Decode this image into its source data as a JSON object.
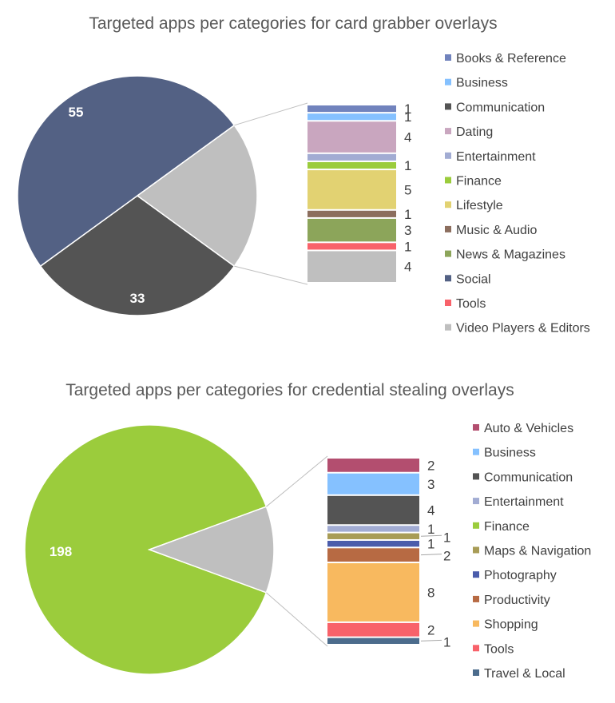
{
  "chart_data": [
    {
      "type": "pie",
      "subtype": "bar-of-pie",
      "title": "Targeted apps per categories for card grabber overlays",
      "legend_position": "right",
      "pie": [
        {
          "label": "Social",
          "value": 55,
          "color": "#536184"
        },
        {
          "label": "Communication",
          "value": 33,
          "color": "#545454"
        },
        {
          "label": "Other",
          "value": 22,
          "color": "#bfbfbf"
        }
      ],
      "bar": [
        {
          "label": "Books & Reference",
          "value": 1,
          "color": "#7183bd",
          "show_label": true
        },
        {
          "label": "Business",
          "value": 1,
          "color": "#85c1ff",
          "show_label": true
        },
        {
          "label": "Dating",
          "value": 4,
          "color": "#c9a6bf",
          "show_label": true
        },
        {
          "label": "Entertainment",
          "value": 1,
          "color": "#a2acd3",
          "show_label": false
        },
        {
          "label": "Finance",
          "value": 1,
          "color": "#9bcc3c",
          "show_label": true
        },
        {
          "label": "Lifestyle",
          "value": 5,
          "color": "#e2d272",
          "show_label": true
        },
        {
          "label": "Music & Audio",
          "value": 1,
          "color": "#8c6e5e",
          "show_label": true
        },
        {
          "label": "News & Magazines",
          "value": 3,
          "color": "#8ca55a",
          "show_label": true
        },
        {
          "label": "Tools",
          "value": 1,
          "color": "#f8626a",
          "show_label": true
        },
        {
          "label": "Video Players & Editors",
          "value": 4,
          "color": "#bfbfbf",
          "show_label": true
        }
      ],
      "legend": [
        "Books & Reference",
        "Business",
        "Communication",
        "Dating",
        "Entertainment",
        "Finance",
        "Lifestyle",
        "Music & Audio",
        "News & Magazines",
        "Social",
        "Tools",
        "Video Players & Editors"
      ],
      "legend_colors": [
        "#7183bd",
        "#85c1ff",
        "#545454",
        "#c9a6bf",
        "#a2acd3",
        "#9bcc3c",
        "#e2d272",
        "#8c6e5e",
        "#8ca55a",
        "#536184",
        "#f8626a",
        "#bfbfbf"
      ]
    },
    {
      "type": "pie",
      "subtype": "bar-of-pie",
      "title": "Targeted apps per categories for credential stealing overlays",
      "legend_position": "right",
      "pie": [
        {
          "label": "Finance",
          "value": 198,
          "color": "#9bcc3c"
        },
        {
          "label": "Other",
          "value": 25,
          "color": "#bfbfbf"
        }
      ],
      "bar": [
        {
          "label": "Auto & Vehicles",
          "value": 2,
          "color": "#b34e6f"
        },
        {
          "label": "Business",
          "value": 3,
          "color": "#85c1ff"
        },
        {
          "label": "Communication",
          "value": 4,
          "color": "#545454"
        },
        {
          "label": "Entertainment",
          "value": 1,
          "color": "#a2acd3"
        },
        {
          "label": "Maps & Navigation",
          "value": 1,
          "color": "#a89c56"
        },
        {
          "label": "Photography",
          "value": 1,
          "color": "#4a5cab"
        },
        {
          "label": "Productivity",
          "value": 2,
          "color": "#b76a43"
        },
        {
          "label": "Shopping",
          "value": 8,
          "color": "#f8b95f"
        },
        {
          "label": "Tools",
          "value": 2,
          "color": "#f8626a"
        },
        {
          "label": "Travel & Local",
          "value": 1,
          "color": "#4c6c8c"
        }
      ],
      "legend": [
        "Auto & Vehicles",
        "Business",
        "Communication",
        "Entertainment",
        "Finance",
        "Maps & Navigation",
        "Photography",
        "Productivity",
        "Shopping",
        "Tools",
        "Travel & Local"
      ],
      "legend_colors": [
        "#b34e6f",
        "#85c1ff",
        "#545454",
        "#a2acd3",
        "#9bcc3c",
        "#a89c56",
        "#4a5cab",
        "#b76a43",
        "#f8b95f",
        "#f8626a",
        "#4c6c8c"
      ]
    }
  ]
}
